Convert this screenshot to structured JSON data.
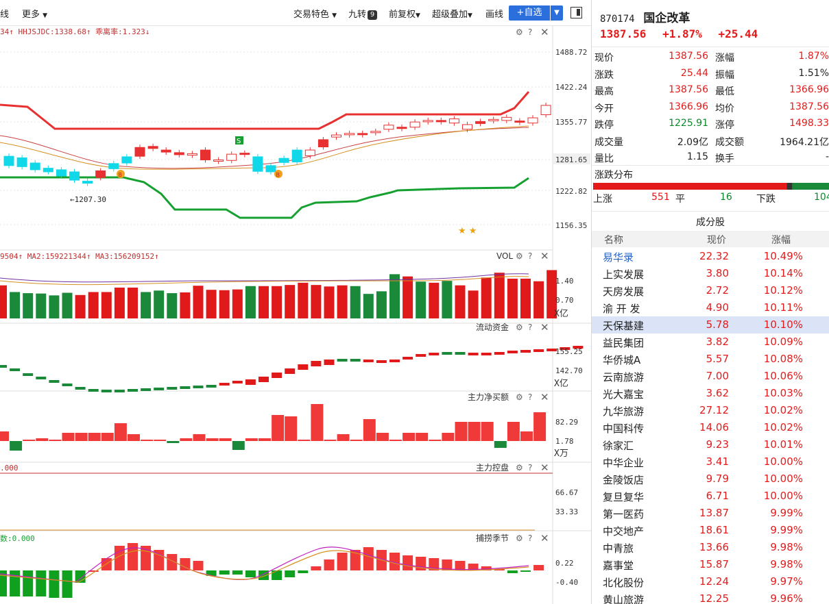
{
  "toolbar": {
    "left_cut": "线",
    "more": "更多",
    "trade_feature": "交易特色",
    "jiuzhuan": "九转",
    "jiuzhuan_badge": "9",
    "fq": "前复权",
    "overlay": "超级叠加",
    "draw": "画线",
    "add_watch": "+自选"
  },
  "main_chart": {
    "indicator_text": "34↑ HHJSJDC:1338.68↑ 乖离率:1.323↓",
    "y_ticks": [
      "1488.72",
      "1422.24",
      "1355.77",
      "1281.65",
      "1222.82",
      "1156.35"
    ],
    "low_marker": "←1207.30",
    "signal_s": "S",
    "signal_b": "B",
    "stars": "★ ★"
  },
  "vol_panel": {
    "indicator_text": "9504↑ MA2:159221344↑ MA3:156209152↑",
    "label": "VOL",
    "y_ticks": [
      "1.40",
      "0.70"
    ],
    "unit": "X亿"
  },
  "flow_panel": {
    "label": "流动资金",
    "y_ticks": [
      "155.25",
      "142.70"
    ],
    "unit": "X亿"
  },
  "net_panel": {
    "label": "主力净买额",
    "y_ticks": [
      "82.29",
      "1.78"
    ],
    "unit": "X万"
  },
  "control_panel": {
    "label": "主力控盘",
    "left_value": ".000",
    "y_ticks": [
      "66.67",
      "33.33"
    ]
  },
  "season_panel": {
    "label": "捕捞季节",
    "left_value": "数:0.000",
    "y_ticks": [
      "0.22",
      "-0.40"
    ]
  },
  "quote": {
    "code": "870174",
    "name": "国企改革",
    "price": "1387.56",
    "pct": "+1.87%",
    "chg": "+25.44",
    "rows": [
      {
        "l1": "现价",
        "v1": "1387.56",
        "c1": "red",
        "l2": "涨幅",
        "v2": "1.87%",
        "c2": "red"
      },
      {
        "l1": "涨跌",
        "v1": "25.44",
        "c1": "red",
        "l2": "振幅",
        "v2": "1.51%",
        "c2": ""
      },
      {
        "l1": "最高",
        "v1": "1387.56",
        "c1": "red",
        "l2": "最低",
        "v2": "1366.96",
        "c2": "red"
      },
      {
        "l1": "今开",
        "v1": "1366.96",
        "c1": "red",
        "l2": "均价",
        "v2": "1387.56",
        "c2": "red"
      },
      {
        "l1": "跌停",
        "v1": "1225.91",
        "c1": "green",
        "l2": "涨停",
        "v2": "1498.33",
        "c2": "red"
      },
      {
        "l1": "成交量",
        "v1": "2.09亿",
        "c1": "",
        "l2": "成交额",
        "v2": "1964.21亿",
        "c2": ""
      },
      {
        "l1": "量比",
        "v1": "1.15",
        "c1": "",
        "l2": "换手",
        "v2": "-",
        "c2": ""
      }
    ],
    "dist_title": "涨跌分布",
    "up_label": "上涨",
    "up": "551",
    "flat_label": "平",
    "flat": "16",
    "down_label": "下跌",
    "down": "104"
  },
  "components": {
    "title": "成分股",
    "headers": [
      "名称",
      "现价",
      "涨幅"
    ],
    "rows": [
      {
        "name": "易华录",
        "price": "22.32",
        "pct": "10.49%"
      },
      {
        "name": "上实发展",
        "price": "3.80",
        "pct": "10.14%"
      },
      {
        "name": "天房发展",
        "price": "2.72",
        "pct": "10.12%"
      },
      {
        "name": "渝 开 发",
        "price": "4.90",
        "pct": "10.11%"
      },
      {
        "name": "天保基建",
        "price": "5.78",
        "pct": "10.10%"
      },
      {
        "name": "益民集团",
        "price": "3.82",
        "pct": "10.09%"
      },
      {
        "name": "华侨城A",
        "price": "5.57",
        "pct": "10.08%"
      },
      {
        "name": "云南旅游",
        "price": "7.00",
        "pct": "10.06%"
      },
      {
        "name": "光大嘉宝",
        "price": "3.62",
        "pct": "10.03%"
      },
      {
        "name": "九华旅游",
        "price": "27.12",
        "pct": "10.02%"
      },
      {
        "name": "中国科传",
        "price": "14.06",
        "pct": "10.02%"
      },
      {
        "name": "徐家汇",
        "price": "9.23",
        "pct": "10.01%"
      },
      {
        "name": "中华企业",
        "price": "3.41",
        "pct": "10.00%"
      },
      {
        "name": "金陵饭店",
        "price": "9.79",
        "pct": "10.00%"
      },
      {
        "name": "复旦复华",
        "price": "6.71",
        "pct": "10.00%"
      },
      {
        "name": "第一医药",
        "price": "13.87",
        "pct": "9.99%"
      },
      {
        "name": "中交地产",
        "price": "18.61",
        "pct": "9.99%"
      },
      {
        "name": "中青旅",
        "price": "13.66",
        "pct": "9.98%"
      },
      {
        "name": "嘉事堂",
        "price": "15.87",
        "pct": "9.98%"
      },
      {
        "name": "北化股份",
        "price": "12.24",
        "pct": "9.97%"
      },
      {
        "name": "黄山旅游",
        "price": "12.25",
        "pct": "9.96%"
      }
    ]
  },
  "chart_data": {
    "type": "candlestick",
    "ylim": [
      1156.35,
      1488.72
    ],
    "candles": [
      {
        "o": 1288,
        "c": 1270
      },
      {
        "o": 1285,
        "c": 1268
      },
      {
        "o": 1275,
        "c": 1262
      },
      {
        "o": 1265,
        "c": 1258
      },
      {
        "o": 1262,
        "c": 1250
      },
      {
        "o": 1258,
        "c": 1242
      },
      {
        "o": 1240,
        "c": 1236
      },
      {
        "o": 1247,
        "c": 1260
      },
      {
        "o": 1264,
        "c": 1274
      },
      {
        "o": 1275,
        "c": 1287
      },
      {
        "o": 1288,
        "c": 1305
      },
      {
        "o": 1303,
        "c": 1307
      },
      {
        "o": 1300,
        "c": 1296
      },
      {
        "o": 1295,
        "c": 1291
      },
      {
        "o": 1293,
        "c": 1290
      },
      {
        "o": 1300,
        "c": 1281
      },
      {
        "o": 1281,
        "c": 1279
      },
      {
        "o": 1280,
        "c": 1292
      },
      {
        "o": 1294,
        "c": 1294
      },
      {
        "o": 1287,
        "c": 1259
      },
      {
        "o": 1270,
        "c": 1258
      },
      {
        "o": 1276,
        "c": 1284
      },
      {
        "o": 1277,
        "c": 1300
      },
      {
        "o": 1289,
        "c": 1300
      },
      {
        "o": 1306,
        "c": 1320
      },
      {
        "o": 1325,
        "c": 1329
      },
      {
        "o": 1330,
        "c": 1332
      },
      {
        "o": 1332,
        "c": 1332
      },
      {
        "o": 1336,
        "c": 1336
      },
      {
        "o": 1340,
        "c": 1348
      },
      {
        "o": 1344,
        "c": 1344
      },
      {
        "o": 1344,
        "c": 1354
      },
      {
        "o": 1355,
        "c": 1357
      },
      {
        "o": 1357,
        "c": 1357
      },
      {
        "o": 1360,
        "c": 1352
      },
      {
        "o": 1340,
        "c": 1349
      },
      {
        "o": 1351,
        "c": 1355
      },
      {
        "o": 1359,
        "c": 1359
      },
      {
        "o": 1363,
        "c": 1357
      },
      {
        "o": 1356,
        "c": 1356
      },
      {
        "o": 1352,
        "c": 1362
      },
      {
        "o": 1368,
        "c": 1386
      }
    ],
    "vol": [
      1.24,
      1.06,
      1.03,
      1.02,
      0.97,
      1.04,
      0.98,
      1.06,
      1.06,
      1.18,
      1.18,
      1.06,
      1.1,
      1.03,
      1.05,
      1.23,
      1.12,
      1.11,
      1.13,
      1.22,
      1.22,
      1.22,
      1.25,
      1.31,
      1.25,
      1.21,
      1.24,
      1.22,
      1.01,
      1.08,
      1.54,
      1.48,
      1.34,
      1.31,
      1.36,
      1.24,
      1.1,
      1.45,
      1.58,
      1.42,
      1.42,
      1.35,
      1.65
    ],
    "vol_up": [
      1,
      0,
      0,
      0,
      0,
      0,
      1,
      1,
      1,
      1,
      1,
      0,
      0,
      0,
      1,
      1,
      1,
      1,
      1,
      0,
      1,
      1,
      1,
      1,
      1,
      1,
      1,
      0,
      0,
      0,
      0,
      1,
      0,
      1,
      0,
      1,
      1,
      1,
      1,
      1,
      1,
      1,
      1
    ]
  }
}
